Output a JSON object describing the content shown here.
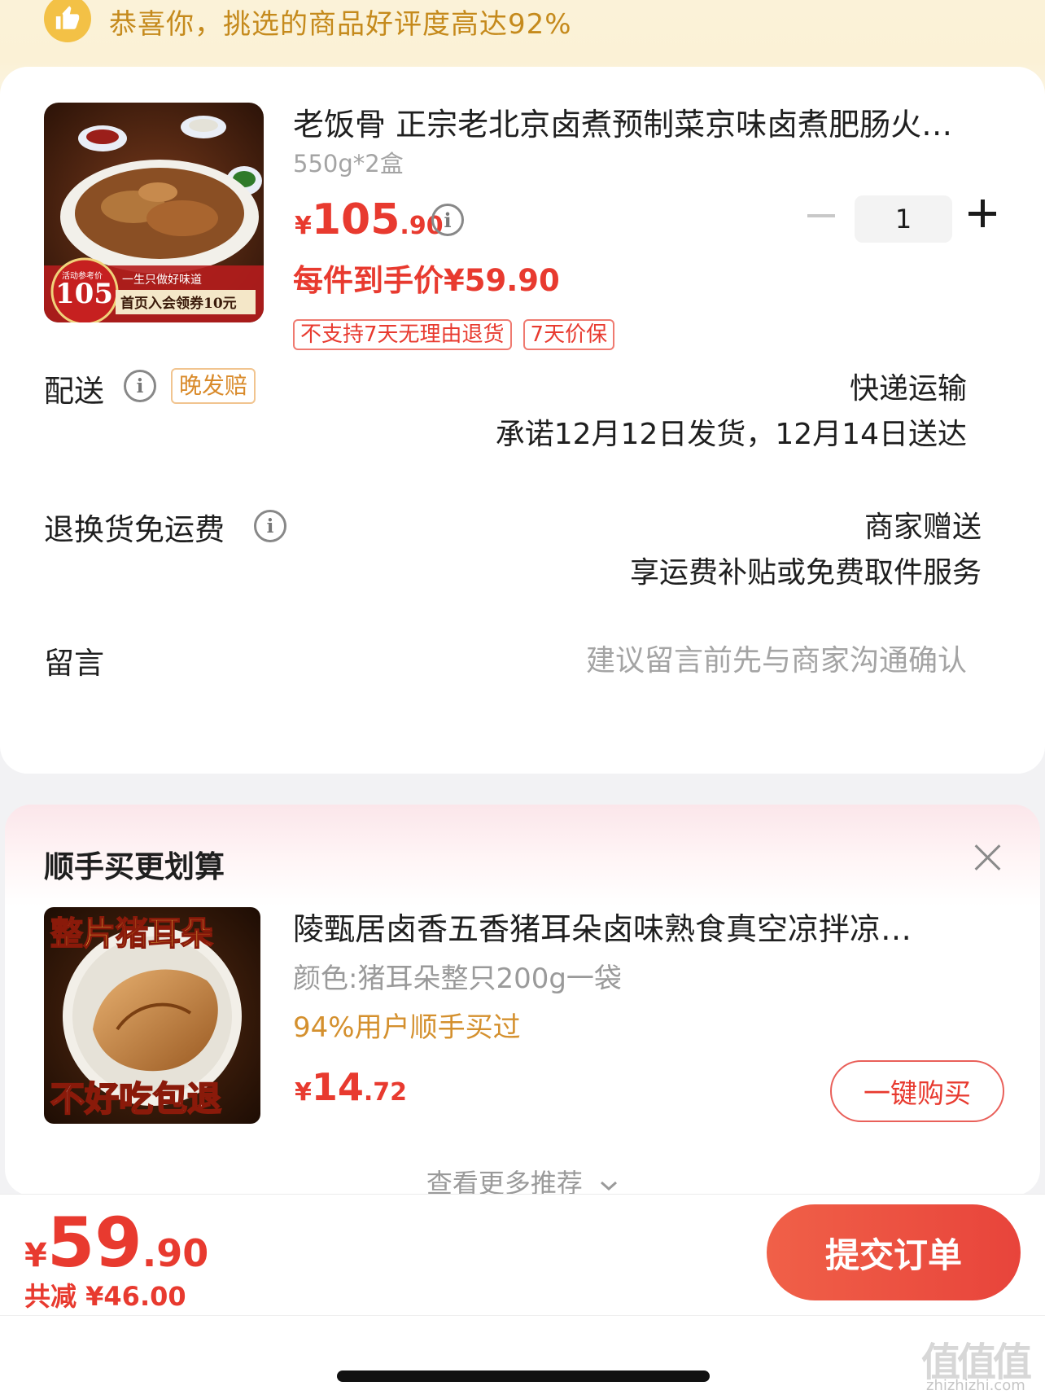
{
  "banner": {
    "text": "恭喜你，挑选的商品好评度高达92%",
    "icon": "thumbs-up-icon"
  },
  "product": {
    "title": "老饭骨 正宗老北京卤煮预制菜京味卤煮肥肠火…",
    "spec": "550g*2盒",
    "price_currency": "¥",
    "price_int": "105",
    "price_dec": ".90",
    "final_price": "每件到手价¥59.90",
    "quantity": "1",
    "tags": [
      "不支持7天无理由退货",
      "7天价保"
    ],
    "image_text": {
      "ref_label": "活动参考价",
      "ref_price": "105",
      "slogan": "一生只做好味道",
      "coupon": "首页入会领券10元"
    }
  },
  "delivery": {
    "label": "配送",
    "tag": "晚发赔",
    "method": "快递运输",
    "promise": "承诺12月12日发货，12月14日送达"
  },
  "return_shipping": {
    "label": "退换货免运费",
    "provider": "商家赠送",
    "detail": "享运费补贴或免费取件服务"
  },
  "message": {
    "label": "留言",
    "placeholder": "建议留言前先与商家沟通确认"
  },
  "recommend": {
    "title": "顺手买更划算",
    "item": {
      "name": "陵甄居卤香五香猪耳朵卤味熟食真空凉拌凉…",
      "spec": "颜色:猪耳朵整只200g一袋",
      "social": "94%用户顺手买过",
      "price_currency": "¥",
      "price_int": "14",
      "price_dec": ".72",
      "buy_label": "一键购买",
      "image_text": {
        "top": "整片猪耳朵",
        "bottom": "不好吃包退"
      }
    },
    "more_label": "查看更多推荐"
  },
  "footer": {
    "total_currency": "¥",
    "total_int": "59",
    "total_dec": ".90",
    "saved": "共减 ¥46.00",
    "submit_label": "提交订单"
  },
  "watermark": {
    "mark": "值值值",
    "sub": "zhizhizhi.com"
  },
  "colors": {
    "accent": "#e83a2f",
    "banner_text": "#c58a1c",
    "social_text": "#d4902e"
  }
}
